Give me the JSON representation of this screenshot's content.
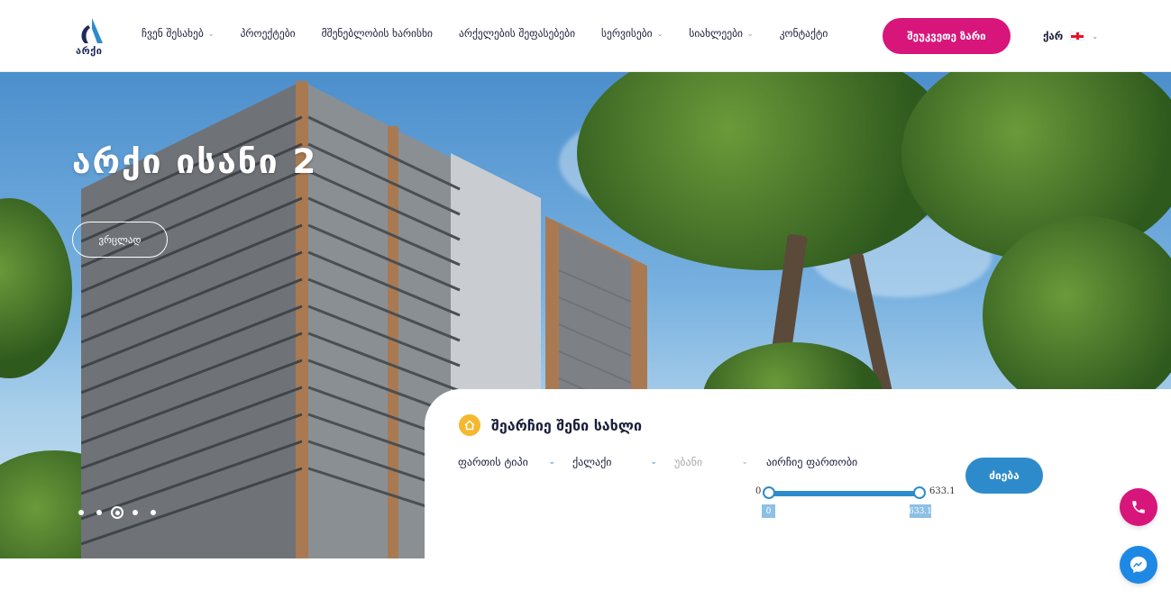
{
  "brand": {
    "logo_text": "არქი",
    "accent": "#d8157a",
    "primary": "#2e8bcb",
    "highlight": "#f5b82e"
  },
  "nav": {
    "items": [
      {
        "label": "ჩვენ შესახებ",
        "has_dropdown": true
      },
      {
        "label": "პროექტები",
        "has_dropdown": false
      },
      {
        "label": "მშენებლობის ხარისხი",
        "has_dropdown": false
      },
      {
        "label": "არქელების შეფასებები",
        "has_dropdown": false
      },
      {
        "label": "სერვისები",
        "has_dropdown": true
      },
      {
        "label": "სიახლეები",
        "has_dropdown": true
      },
      {
        "label": "კონტაქტი",
        "has_dropdown": false
      }
    ],
    "cta_label": "შეუკვეთე ზარი",
    "language": "ქარ"
  },
  "hero": {
    "title": "არქი ისანი 2",
    "details_label": "ვრცლად",
    "slides_count": 5,
    "active_slide": 3
  },
  "search": {
    "title": "შეარჩიე შენი სახლი",
    "property_type": "ფართის ტიპი",
    "city": "ქალაქი",
    "district": "უბანი",
    "area_label": "აირჩიე ფართობი",
    "area_min": "0",
    "area_max": "633.1",
    "selected_min": "0",
    "selected_max": "633.1",
    "button_label": "ძიება"
  },
  "floating": {
    "phone_icon": "phone-icon",
    "messenger_icon": "messenger-icon"
  }
}
